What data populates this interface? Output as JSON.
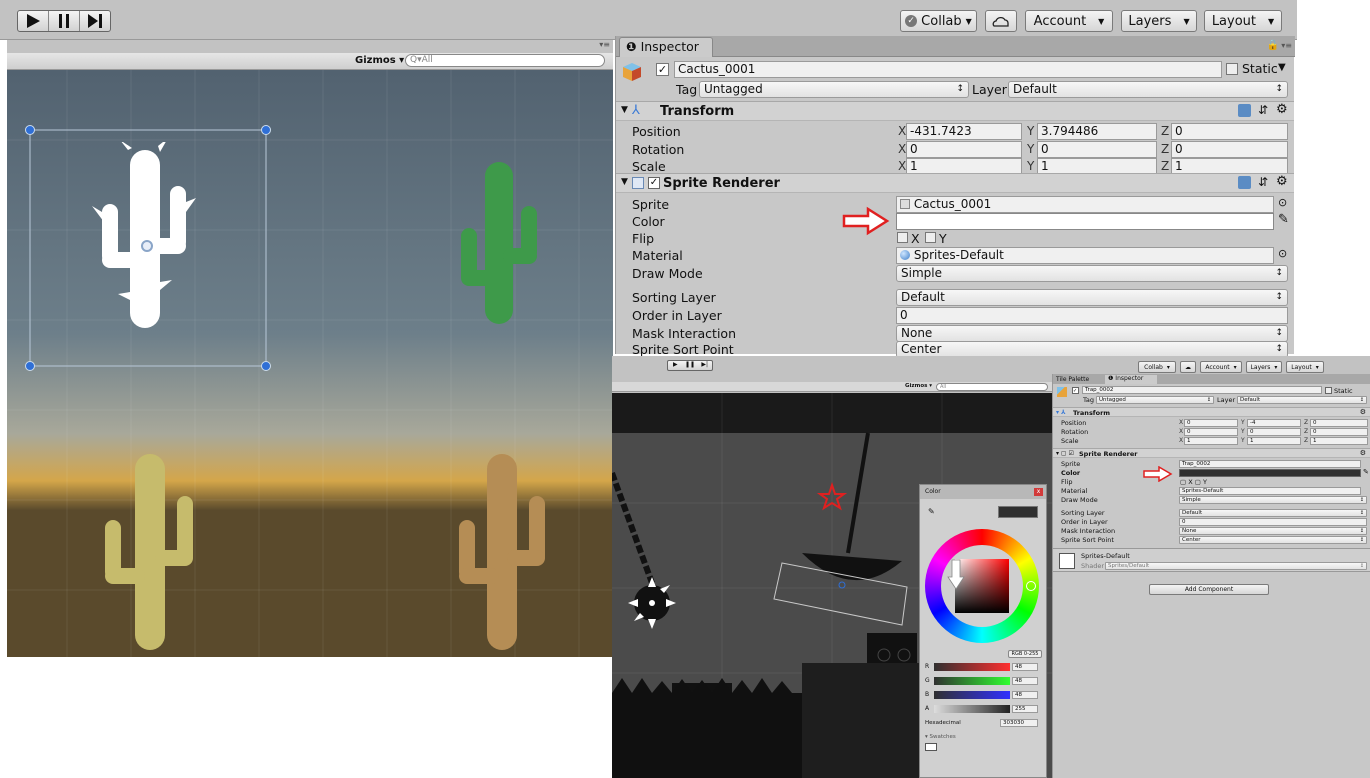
{
  "toolbar": {
    "play_icon": "play-icon",
    "pause_icon": "pause-icon",
    "step_icon": "step-icon",
    "collab_label": "Collab",
    "account_label": "Account",
    "layers_label": "Layers",
    "layout_label": "Layout"
  },
  "scene": {
    "gizmos_label": "Gizmos",
    "search_placeholder": "All"
  },
  "inspector": {
    "tab_label": "Inspector",
    "object_name": "Cactus_0001",
    "static_label": "Static",
    "tag_label": "Tag",
    "tag_value": "Untagged",
    "layer_label": "Layer",
    "layer_value": "Default",
    "transform": {
      "title": "Transform",
      "position_label": "Position",
      "rotation_label": "Rotation",
      "scale_label": "Scale",
      "position": {
        "x": "-431.7423",
        "y": "3.794486",
        "z": "0"
      },
      "rotation": {
        "x": "0",
        "y": "0",
        "z": "0"
      },
      "scale": {
        "x": "1",
        "y": "1",
        "z": "1"
      }
    },
    "sprite_renderer": {
      "title": "Sprite Renderer",
      "sprite_label": "Sprite",
      "sprite_value": "Cactus_0001",
      "color_label": "Color",
      "color_value": "#ffffff",
      "flip_label": "Flip",
      "flip_x": "X",
      "flip_y": "Y",
      "material_label": "Material",
      "material_value": "Sprites-Default",
      "draw_mode_label": "Draw Mode",
      "draw_mode_value": "Simple",
      "sorting_layer_label": "Sorting Layer",
      "sorting_layer_value": "Default",
      "order_label": "Order in Layer",
      "order_value": "0",
      "mask_label": "Mask Interaction",
      "mask_value": "None",
      "sort_point_label": "Sprite Sort Point",
      "sort_point_value": "Center"
    }
  },
  "inset": {
    "toolbar": {
      "collab_label": "Collab",
      "account_label": "Account",
      "layers_label": "Layers",
      "layout_label": "Layout"
    },
    "scene": {
      "gizmos_label": "Gizmos",
      "search_placeholder": "All"
    },
    "tabs": [
      "Tile Palette",
      "Inspector"
    ],
    "object_name": "Trap_0002",
    "static_label": "Static",
    "tag_label": "Tag",
    "tag_value": "Untagged",
    "layer_label": "Layer",
    "layer_value": "Default",
    "transform": {
      "title": "Transform",
      "position_label": "Position",
      "rotation_label": "Rotation",
      "scale_label": "Scale",
      "position": {
        "x": "0",
        "y": "-4",
        "z": "0"
      },
      "rotation": {
        "x": "0",
        "y": "0",
        "z": "0"
      },
      "scale": {
        "x": "1",
        "y": "1",
        "z": "1"
      }
    },
    "sprite_renderer": {
      "title": "Sprite Renderer",
      "sprite_label": "Sprite",
      "sprite_value": "Trap_0002",
      "color_label": "Color",
      "color_value": "#303030",
      "flip_label": "Flip",
      "flip_x": "X",
      "flip_y": "Y",
      "material_label": "Material",
      "material_value": "Sprites-Default",
      "draw_mode_label": "Draw Mode",
      "draw_mode_value": "Simple",
      "sorting_layer_label": "Sorting Layer",
      "sorting_layer_value": "Default",
      "order_label": "Order in Layer",
      "order_value": "0",
      "mask_label": "Mask Interaction",
      "mask_value": "None",
      "sort_point_label": "Sprite Sort Point",
      "sort_point_value": "Center"
    },
    "material_block": {
      "name": "Sprites-Default",
      "shader_label": "Shader",
      "shader_value": "Sprites/Default"
    },
    "add_component_label": "Add Component",
    "color_picker": {
      "title": "Color",
      "mode_label": "RGB 0-255",
      "r_label": "R",
      "r_value": "48",
      "g_label": "G",
      "g_value": "48",
      "b_label": "B",
      "b_value": "48",
      "a_label": "A",
      "a_value": "255",
      "hex_label": "Hexadecimal",
      "hex_value": "303030",
      "swatches_label": "Swatches",
      "current_color": "#303030"
    }
  },
  "colors": {
    "cactus_green": "#3e9a4a",
    "cactus_yellow": "#c6bb6c",
    "cactus_orange": "#b58d55",
    "sky_top": "#4f606d",
    "ground": "#5a4a2c",
    "arrow_red": "#e02020"
  }
}
